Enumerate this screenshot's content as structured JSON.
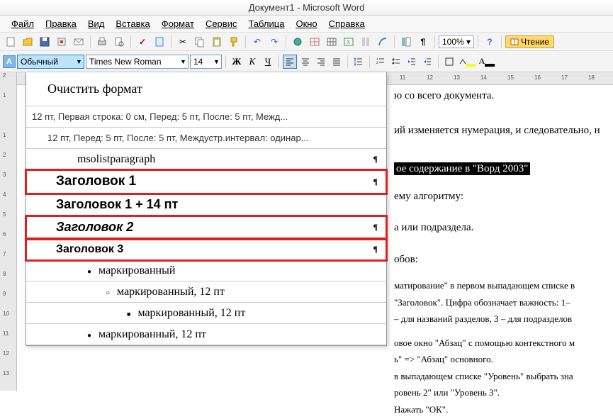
{
  "window": {
    "title": "Документ1 - Microsoft Word"
  },
  "menus": {
    "file": "Файл",
    "edit": "Правка",
    "view": "Вид",
    "insert": "Вставка",
    "format": "Формат",
    "tools": "Сервис",
    "table": "Таблица",
    "window": "Окно",
    "help": "Справка"
  },
  "toolbar": {
    "zoom": "100%",
    "reading": "Чтение"
  },
  "format_bar": {
    "style": "Обычный",
    "font": "Times New Roman",
    "size": "14",
    "b": "Ж",
    "i": "К",
    "u": "Ч"
  },
  "style_panel": {
    "clear": "Очистить формат",
    "desc1": "12 пт, Первая строка:  0 см, Перед:  5 пт, После:  5 пт, Межд...",
    "desc2": "12 пт, Перед:  5 пт, После:  5 пт, Междустр.интервал:  одинар...",
    "msolist": "msolistparagraph",
    "h1": "Заголовок 1",
    "h1plus": "Заголовок 1 + 14 пт",
    "h2": "Заголовок 2",
    "h3": "Заголовок 3",
    "m1": "маркированный",
    "m2": "маркированный, 12 пт",
    "m3": "маркированный, 12 пт",
    "m4": "маркированный, 12 пт",
    "pil": "¶"
  },
  "document": {
    "l1": "ю со всего документа.",
    "l2": "ий изменяется нумерация, и следовательно, н",
    "hl": "ое содержание в \"Ворд 2003\"",
    "l3": "ему алгоритму:",
    "l4": "а или подраздела.",
    "l5": "обов:",
    "p1a": "матирование\" в первом выпадающем списке в",
    "p1b": "\"Заголовок\". Цифра обозначает важность: 1–",
    "p1c": "– для названий разделов, 3 – для подразделов",
    "p2a": "овое окно \"Абзац\" с помощью контекстного м",
    "p2b": "ь\" => \"Абзац\" основного.",
    "p3a": "в выпадающем списке \"Уровень\" выбрать зна",
    "p3b": "ровень 2\" или \"Уровень 3\".",
    "p4": "Нажать \"ОК\"."
  },
  "ruler": {
    "v": [
      "2",
      "1",
      "",
      "1",
      "2",
      "3",
      "4",
      "5",
      "6",
      "7",
      "8",
      "9",
      "10",
      "11",
      "12",
      "13"
    ],
    "h": [
      "11",
      "12",
      "13",
      "14",
      "15",
      "16",
      "17",
      "18"
    ]
  }
}
